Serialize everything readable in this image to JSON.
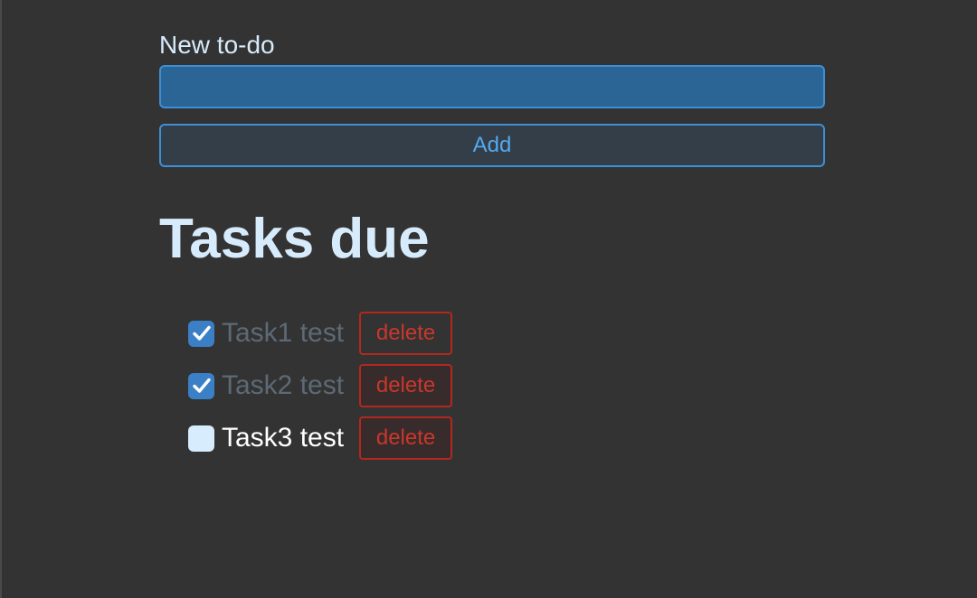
{
  "form": {
    "label": "New to-do",
    "input_value": "",
    "input_placeholder": "",
    "add_label": "Add"
  },
  "heading": "Tasks due",
  "tasks": [
    {
      "text": "Task1 test",
      "done": true,
      "delete_label": "delete"
    },
    {
      "text": "Task2 test",
      "done": true,
      "delete_label": "delete"
    },
    {
      "text": "Task3 test",
      "done": false,
      "delete_label": "delete"
    }
  ],
  "colors": {
    "background": "#333333",
    "accent_blue": "#3d8fd6",
    "input_fill": "#2a6596",
    "heading_text": "#d6ebfb",
    "danger_red": "#c9372c",
    "done_text": "#5d6a75"
  },
  "icons": {
    "check": "checkmark-icon"
  }
}
